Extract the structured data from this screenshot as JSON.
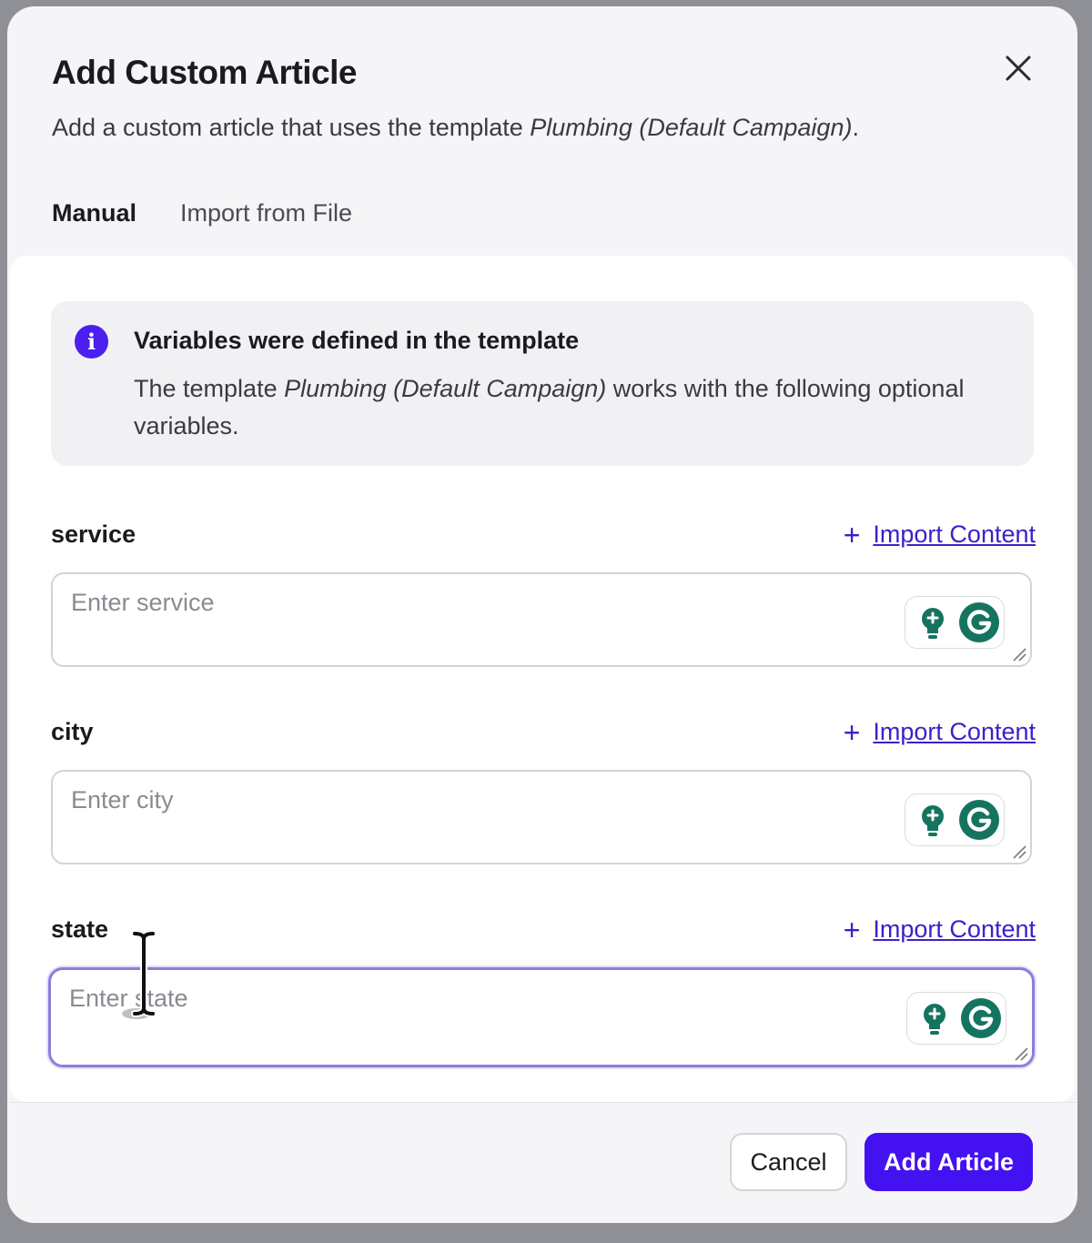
{
  "dialog": {
    "title": "Add Custom Article",
    "subtitle_prefix": "Add a custom article that uses the template ",
    "template_name": "Plumbing (Default Campaign)",
    "subtitle_suffix": ".",
    "close_icon": "close-icon"
  },
  "tabs": [
    {
      "label": "Manual",
      "active": true
    },
    {
      "label": "Import from File",
      "active": false
    }
  ],
  "info": {
    "icon": "info-icon",
    "icon_glyph": "i",
    "title": "Variables were defined in the template",
    "text_prefix": "The template ",
    "template_name": "Plumbing (Default Campaign)",
    "text_suffix": " works with the following optional variables."
  },
  "fields": [
    {
      "label": "service",
      "placeholder": "Enter service",
      "value": "",
      "import_label": "Import Content",
      "plus": "+"
    },
    {
      "label": "city",
      "placeholder": "Enter city",
      "value": "",
      "import_label": "Import Content",
      "plus": "+"
    },
    {
      "label": "state",
      "placeholder": "Enter state",
      "value": "",
      "import_label": "Import Content",
      "plus": "+",
      "focused": true
    }
  ],
  "footer": {
    "cancel_label": "Cancel",
    "submit_label": "Add Article"
  },
  "colors": {
    "accent": "#4411f0",
    "link": "#3b21c9",
    "grammarly_green": "#15745f",
    "focus_border": "#8a80d8"
  }
}
